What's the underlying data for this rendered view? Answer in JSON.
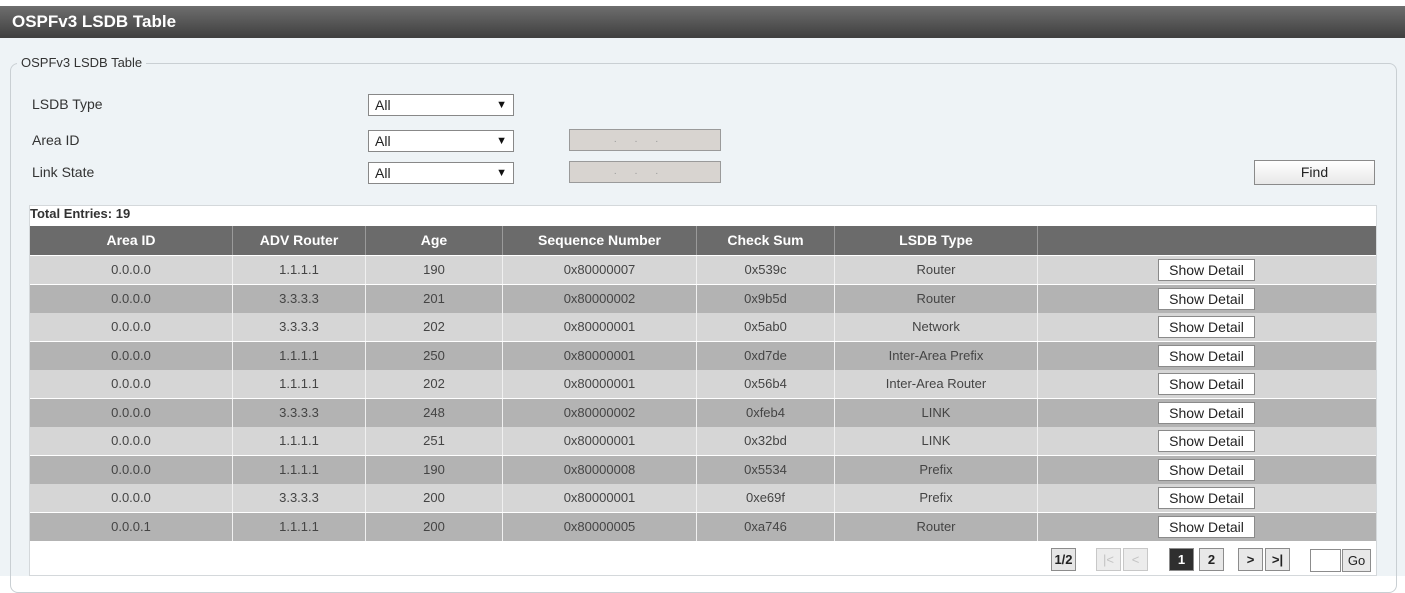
{
  "title": "OSPFv3 LSDB Table",
  "fieldset_title": "OSPFv3 LSDB Table",
  "filters": {
    "lsdb_type_label": "LSDB Type",
    "lsdb_type_value": "All",
    "area_id_label": "Area ID",
    "area_id_value": "All",
    "area_ip_placeholder": "...",
    "link_state_label": "Link State",
    "link_state_value": "All",
    "link_ip_placeholder": "..."
  },
  "find_button": "Find",
  "total_entries": "Total Entries: 19",
  "columns": [
    "Area ID",
    "ADV Router",
    "Age",
    "Sequence Number",
    "Check Sum",
    "LSDB Type",
    ""
  ],
  "rows": [
    {
      "area_id": "0.0.0.0",
      "adv_router": "1.1.1.1",
      "age": "190",
      "seq": "0x80000007",
      "checksum": "0x539c",
      "lsdb_type": "Router",
      "action": "Show Detail"
    },
    {
      "area_id": "0.0.0.0",
      "adv_router": "3.3.3.3",
      "age": "201",
      "seq": "0x80000002",
      "checksum": "0x9b5d",
      "lsdb_type": "Router",
      "action": "Show Detail"
    },
    {
      "area_id": "0.0.0.0",
      "adv_router": "3.3.3.3",
      "age": "202",
      "seq": "0x80000001",
      "checksum": "0x5ab0",
      "lsdb_type": "Network",
      "action": "Show Detail"
    },
    {
      "area_id": "0.0.0.0",
      "adv_router": "1.1.1.1",
      "age": "250",
      "seq": "0x80000001",
      "checksum": "0xd7de",
      "lsdb_type": "Inter-Area Prefix",
      "action": "Show Detail"
    },
    {
      "area_id": "0.0.0.0",
      "adv_router": "1.1.1.1",
      "age": "202",
      "seq": "0x80000001",
      "checksum": "0x56b4",
      "lsdb_type": "Inter-Area Router",
      "action": "Show Detail"
    },
    {
      "area_id": "0.0.0.0",
      "adv_router": "3.3.3.3",
      "age": "248",
      "seq": "0x80000002",
      "checksum": "0xfeb4",
      "lsdb_type": "LINK",
      "action": "Show Detail"
    },
    {
      "area_id": "0.0.0.0",
      "adv_router": "1.1.1.1",
      "age": "251",
      "seq": "0x80000001",
      "checksum": "0x32bd",
      "lsdb_type": "LINK",
      "action": "Show Detail"
    },
    {
      "area_id": "0.0.0.0",
      "adv_router": "1.1.1.1",
      "age": "190",
      "seq": "0x80000008",
      "checksum": "0x5534",
      "lsdb_type": "Prefix",
      "action": "Show Detail"
    },
    {
      "area_id": "0.0.0.0",
      "adv_router": "3.3.3.3",
      "age": "200",
      "seq": "0x80000001",
      "checksum": "0xe69f",
      "lsdb_type": "Prefix",
      "action": "Show Detail"
    },
    {
      "area_id": "0.0.0.1",
      "adv_router": "1.1.1.1",
      "age": "200",
      "seq": "0x80000005",
      "checksum": "0xa746",
      "lsdb_type": "Router",
      "action": "Show Detail"
    }
  ],
  "pagination": {
    "page_info": "1/2",
    "first": "|<",
    "prev": "<",
    "pages": [
      "1",
      "2"
    ],
    "next": ">",
    "last": ">|",
    "go": "Go"
  },
  "dropdown_icon": "▼"
}
